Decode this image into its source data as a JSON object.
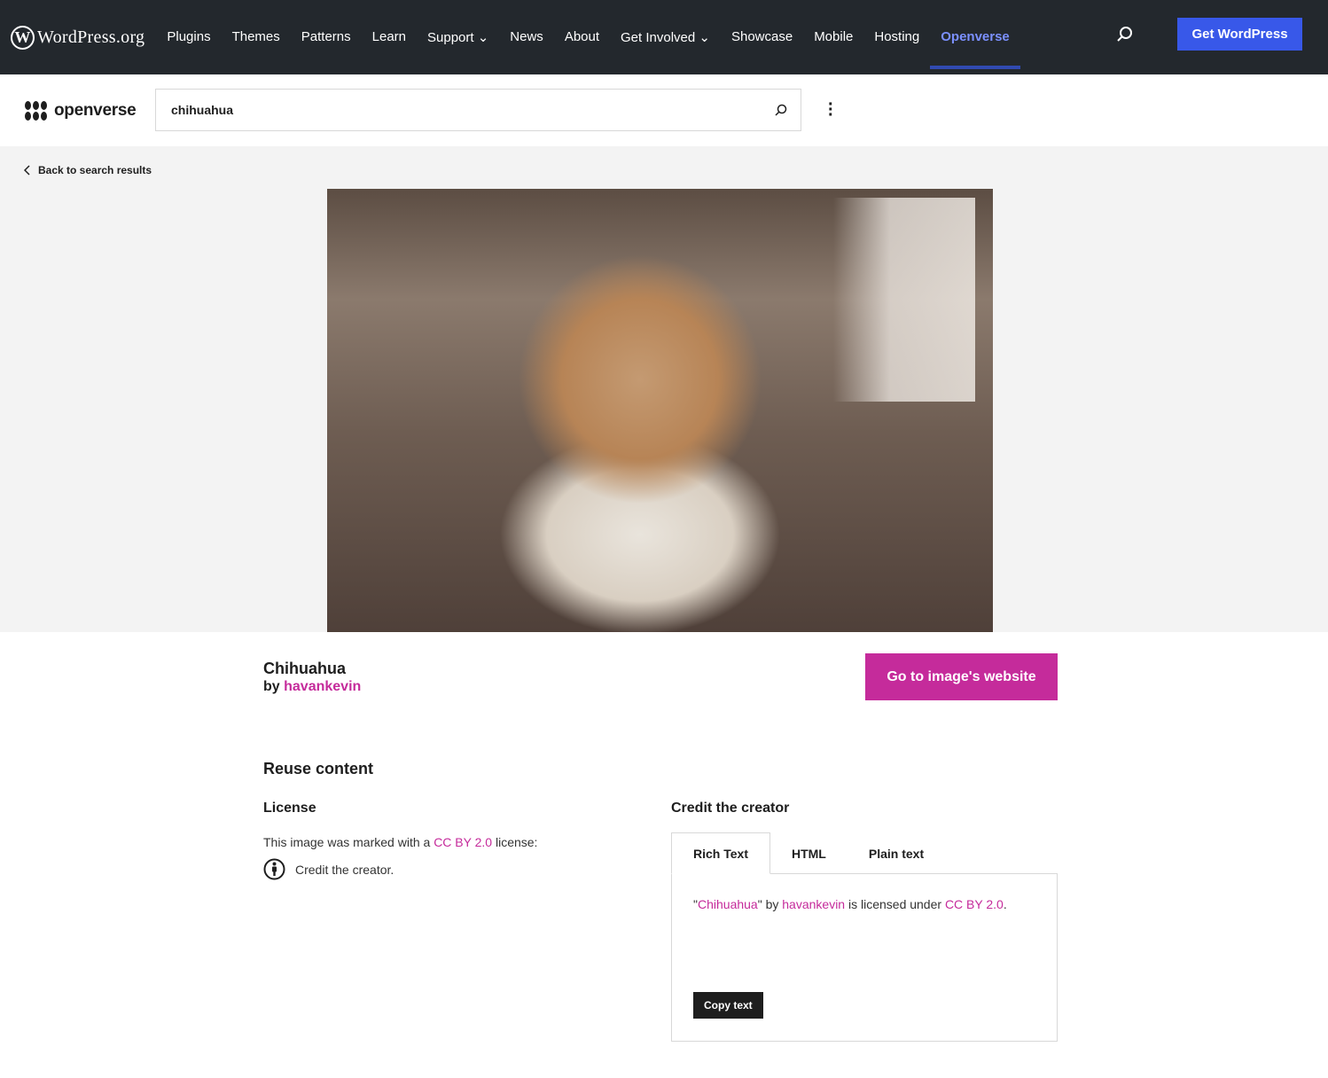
{
  "wp": {
    "logo": "WordPress.org",
    "nav": [
      "Plugins",
      "Themes",
      "Patterns",
      "Learn",
      "Support ⌄",
      "News",
      "About",
      "Get Involved ⌄",
      "Showcase",
      "Mobile",
      "Hosting",
      "Openverse"
    ],
    "cta": "Get WordPress"
  },
  "ov": {
    "logo": "openverse",
    "search_value": "chihuahua"
  },
  "back": "Back to search results",
  "image": {
    "title": "Chihuahua",
    "by": "by ",
    "creator": "havankevin",
    "visit": "Go to image's website"
  },
  "reuse": {
    "heading": "Reuse content",
    "license_heading": "License",
    "license_pre": "This image was marked with a ",
    "license_name": "CC BY 2.0",
    "license_post": " license:",
    "credit_item": "Credit the creator.",
    "credit_heading": "Credit the creator",
    "tabs": [
      "Rich Text",
      "HTML",
      "Plain text"
    ],
    "attr": {
      "q1": "\"",
      "title": "Chihuahua",
      "q2": "\" by ",
      "creator": "havankevin",
      "mid": " is licensed under ",
      "license": "CC BY 2.0",
      "end": "."
    },
    "copy": "Copy text"
  },
  "colors": {
    "accent": "#c52b9b",
    "wp_blue": "#3858e9",
    "wp_bar": "#23282d"
  }
}
